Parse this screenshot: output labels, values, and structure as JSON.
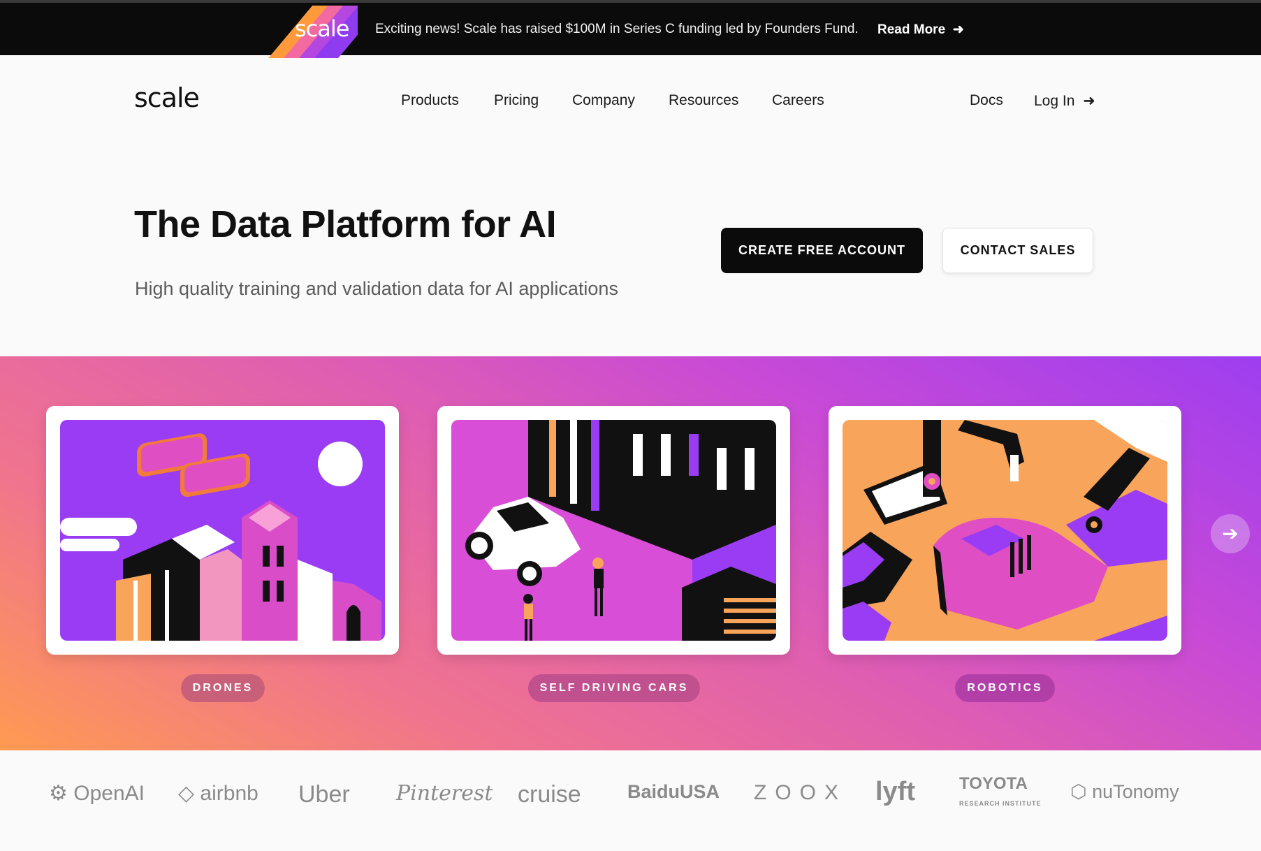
{
  "announcement": {
    "logo_text": "scale",
    "text": "Exciting news! Scale has raised $100M in Series C funding led by Founders Fund.",
    "link_label": "Read More",
    "link_icon": "arrow-right-icon"
  },
  "nav": {
    "brand": "scale",
    "items": [
      "Products",
      "Pricing",
      "Company",
      "Resources",
      "Careers"
    ],
    "docs": "Docs",
    "login": "Log In"
  },
  "hero": {
    "title": "The Data Platform for AI",
    "subtitle": "High quality training and validation data for AI applications",
    "primary_cta": "CREATE FREE ACCOUNT",
    "secondary_cta": "CONTACT SALES"
  },
  "carousel": {
    "cards": [
      {
        "label": "DRONES",
        "pill_color": "#c9607a"
      },
      {
        "label": "SELF DRIVING CARS",
        "pill_color": "#c1508e"
      },
      {
        "label": "ROBOTICS",
        "pill_color": "#b23fa8"
      }
    ],
    "next_icon": "arrow-right-circle-icon"
  },
  "customers": [
    "OpenAI",
    "airbnb",
    "Uber",
    "Pinterest",
    "cruise",
    "BaiduUSA",
    "ZOOX",
    "lyft",
    "TOYOTA",
    "nuTonomy"
  ],
  "customers_sub": {
    "toyota": "RESEARCH INSTITUTE"
  },
  "colors": {
    "accent_purple": "#9b3cf5",
    "accent_orange": "#ff9a52",
    "pink": "#e05fb0"
  }
}
